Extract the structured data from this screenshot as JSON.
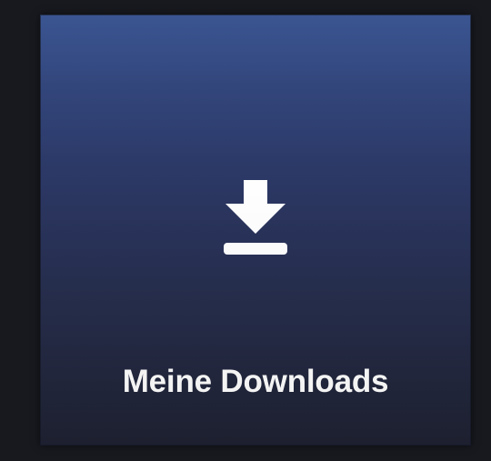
{
  "tile": {
    "label": "Meine Downloads",
    "icon": "download-icon",
    "colors": {
      "gradient_top": "#34508f",
      "gradient_bottom": "#1f2232",
      "text": "#ffffff",
      "background": "#17191f"
    }
  }
}
